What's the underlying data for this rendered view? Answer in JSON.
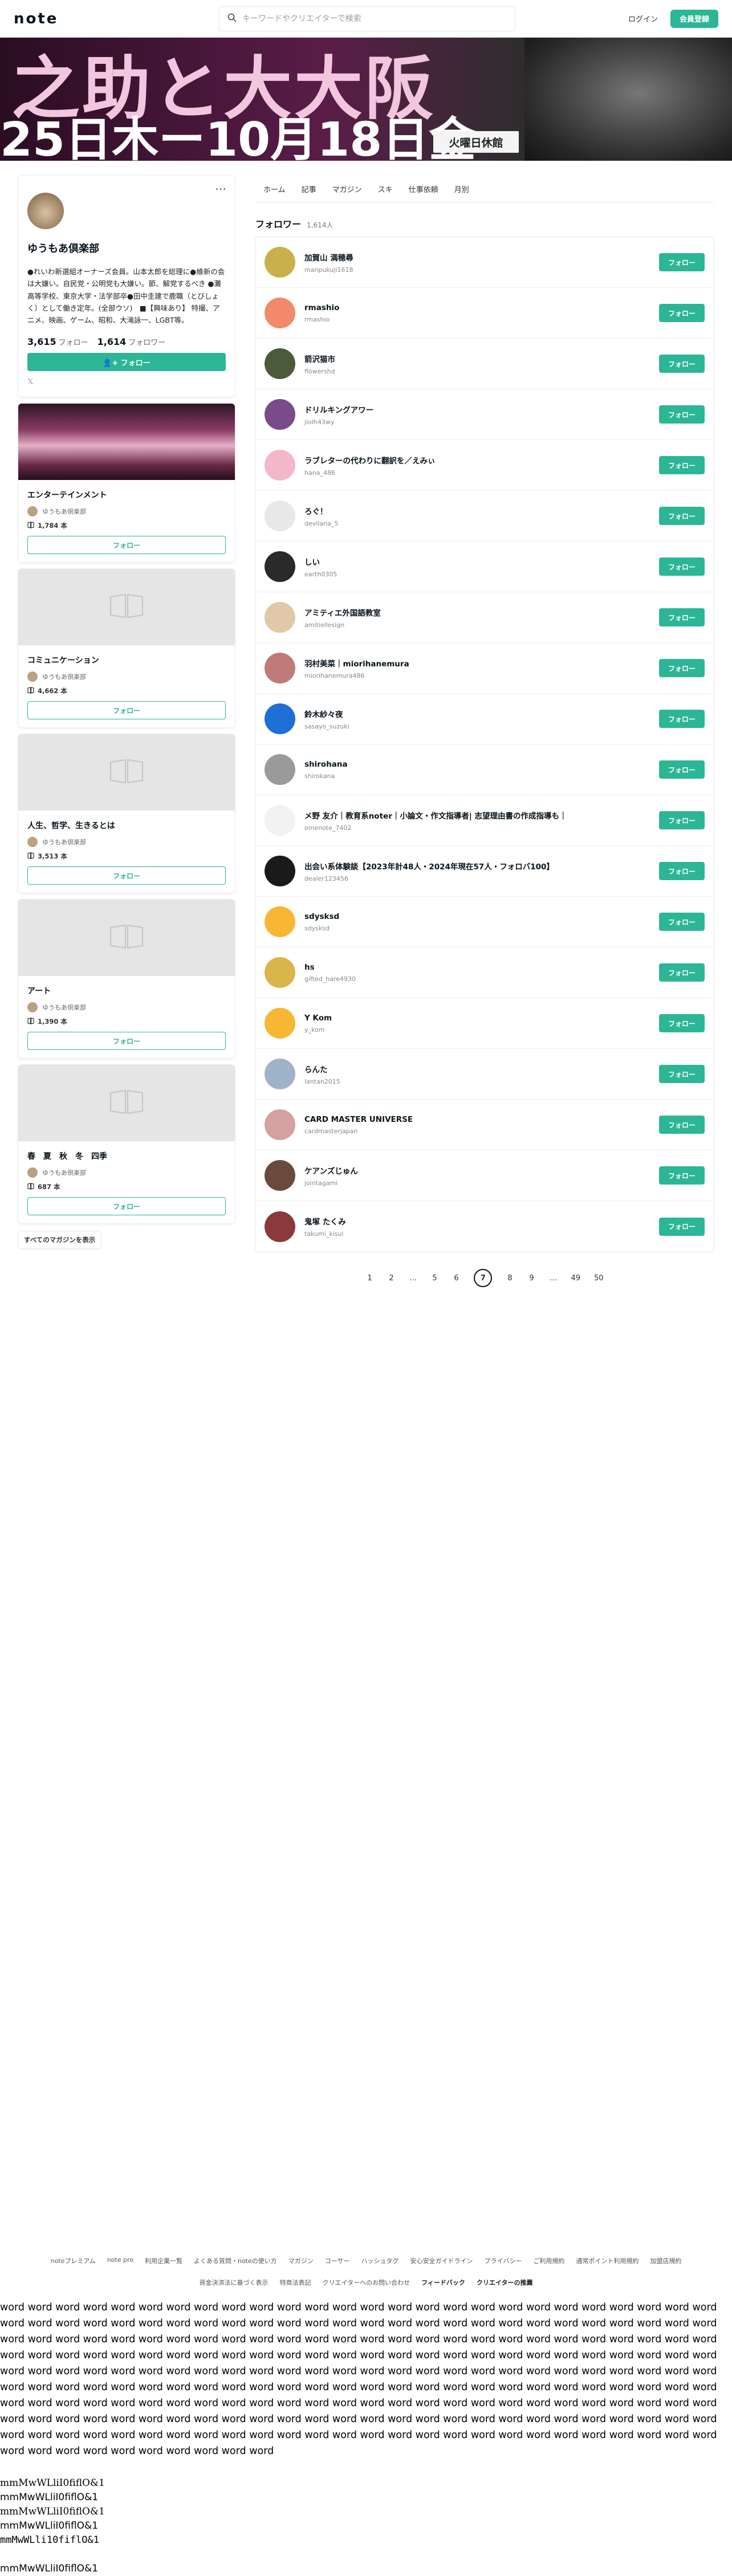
{
  "header": {
    "logo": "note",
    "search_placeholder": "キーワードやクリエイターで検索",
    "login": "ログイン",
    "signup": "会員登録"
  },
  "banner": {
    "line1": "之助と大大阪",
    "line2": "25日木ー10月18日金",
    "badge": "火曜日休館"
  },
  "profile": {
    "more": "…",
    "name": "ゆうもあ倶楽部",
    "bio": "●れいわ新選組オーナーズ会員。山本太郎を総理に●維新の会は大嫌い。自民党・公明党も大嫌い。節、解党するべき ●灘高等学校、東京大学・法学部卒●田中圭建で鹿職（とびしょく）として働き定年。(全部ウソ)　■【興味あり】 特撮、アニメ、映画、ゲーム、昭和、大滝詠一、LGBT等。",
    "following_count": "3,615",
    "following_label": "フォロー",
    "followers_count": "1,614",
    "followers_label": "フォロワー",
    "follow_button": "フォロー",
    "x_label": "𝕏"
  },
  "magazines": [
    {
      "title": "エンターテインメント",
      "author": "ゆうもあ倶楽部",
      "count": "1,784 本",
      "follow": "フォロー",
      "thumb": "photo"
    },
    {
      "title": "コミュニケーション",
      "author": "ゆうもあ倶楽部",
      "count": "4,662 本",
      "follow": "フォロー",
      "thumb": "placeholder"
    },
    {
      "title": "人生、哲学、生きるとは",
      "author": "ゆうもあ倶楽部",
      "count": "3,513 本",
      "follow": "フォロー",
      "thumb": "placeholder"
    },
    {
      "title": "アート",
      "author": "ゆうもあ倶楽部",
      "count": "1,390 本",
      "follow": "フォロー",
      "thumb": "placeholder"
    },
    {
      "title": "春　夏　秋　冬　四季",
      "author": "ゆうもあ倶楽部",
      "count": "687 本",
      "follow": "フォロー",
      "thumb": "placeholder"
    }
  ],
  "all_magazines": "すべてのマガジンを表示",
  "tabs": [
    "ホーム",
    "記事",
    "マガジン",
    "スキ",
    "仕事依頼",
    "月別"
  ],
  "section": {
    "title": "フォロワー",
    "count": "1,614人"
  },
  "followers": [
    {
      "name": "加賀山 満穂尋",
      "id": "manpukuji1618",
      "follow": "フォロー",
      "color": "#c9b04a"
    },
    {
      "name": "rmashio",
      "id": "rmashio",
      "follow": "フォロー",
      "color": "#f08a6a"
    },
    {
      "name": "箭沢猫市",
      "id": "flowershd",
      "follow": "フォロー",
      "color": "#4a5a3a"
    },
    {
      "name": "ドリルキングアワー",
      "id": "jiolh43wy",
      "follow": "フォロー",
      "color": "#7a4a8a"
    },
    {
      "name": "ラブレターの代わりに翻訳を／えみぃ",
      "id": "hana_486",
      "follow": "フォロー",
      "color": "#f3b7c8"
    },
    {
      "name": "ろぐ！",
      "id": "devilana_5",
      "follow": "フォロー",
      "color": "#e8e8e8"
    },
    {
      "name": "しい",
      "id": "earth0305",
      "follow": "フォロー",
      "color": "#2a2a2a"
    },
    {
      "name": "アミティエ外国語教室",
      "id": "amitiellesign",
      "follow": "フォロー",
      "color": "#e0c8a8"
    },
    {
      "name": "羽村美菜｜miorihanemura",
      "id": "miorihanemura486",
      "follow": "フォロー",
      "color": "#c07a7a"
    },
    {
      "name": "鈴木紗々夜",
      "id": "sasayo_suzuki",
      "follow": "フォロー",
      "color": "#1e6fd6"
    },
    {
      "name": "shirohana",
      "id": "shirokana",
      "follow": "フォロー",
      "color": "#9a9a9a"
    },
    {
      "name": "メ野 友介｜教育系noter｜小論文・作文指導者| 志望理由書の作成指導も｜",
      "id": "omenote_7402",
      "follow": "フォロー",
      "color": "#f2f2f2"
    },
    {
      "name": "出会い系体験談【2023年計48人・2024年現在57人・フォロバ100】",
      "id": "dealer123456",
      "follow": "フォロー",
      "color": "#1a1a1a"
    },
    {
      "name": "sdysksd",
      "id": "sdysksd",
      "follow": "フォロー",
      "color": "#f7b733"
    },
    {
      "name": "hs",
      "id": "gifted_hare4930",
      "follow": "フォロー",
      "color": "#d9b54a"
    },
    {
      "name": "Y Kom",
      "id": "y_kom",
      "follow": "フォロー",
      "color": "#f7b733"
    },
    {
      "name": "らんた",
      "id": "lantan2015",
      "follow": "フォロー",
      "color": "#9fb3c8"
    },
    {
      "name": "CARD MASTER UNIVERSE",
      "id": "cardmasterjapan",
      "follow": "フォロー",
      "color": "#d4a0a0"
    },
    {
      "name": "ケアンズじゅん",
      "id": "jointagami",
      "follow": "フォロー",
      "color": "#6a4a3a"
    },
    {
      "name": "鬼塚 たくみ",
      "id": "takumi_kisui",
      "follow": "フォロー",
      "color": "#8a3a3a"
    }
  ],
  "pagination": [
    "1",
    "2",
    "…",
    "5",
    "6",
    "7",
    "8",
    "9",
    "…",
    "49",
    "50"
  ],
  "pagination_current": "7",
  "footer": {
    "row1": [
      "noteプレミアム",
      "note pro",
      "利用企業一覧",
      "よくある質問・noteの使い方",
      "マガジン",
      "コーサー",
      "ハッシュタグ",
      "安心安全ガイドライン",
      "プライバシー",
      "ご利用規約",
      "通常ポイント利用規約",
      "加盟店規約"
    ],
    "row2": [
      "資金決済法に基づく表示",
      "特商法表記",
      "クリエイターへのお問い合わせ",
      "フィードバック",
      "クリエイターの推薦"
    ]
  },
  "word_dump": "word word word word word word word word word word word word word word word word word word word word word word word word word word word word word word word word word word word word word word word word word word word word word word word word word word word word word word word word word word word word word word word word word word word word word word word word word word word word word word word word word word word word word word word word word word word word word word word word word word word word word word word word word word word word word word word word word word word word word word word word word word word word word word word word word word word word word word word word word word word word word word word word word word word word word word word word word word word word word word word word word word word word word word word word word word word word word word word word word word word word word word word word word word word word word word word word word word word word word word word word word word word word word word word word word word word word word word word word word word word word word word word word word word word word word word word word word word word word word word word word word word word word",
  "mono_lines": [
    "mmMwWLliI0fiflO&1",
    "mmMwWLliI0fiflO&1",
    "mmMwWLliI0fiflO&1",
    "mmMwWLliI0fiflO&1",
    "mmMwWLli10fiflO&1",
    "mmMwWLliI0fiflO&1"
  ]
}
